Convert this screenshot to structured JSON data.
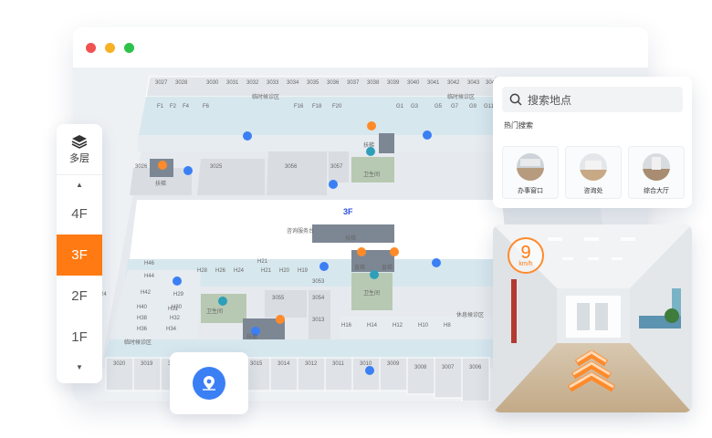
{
  "window": {
    "controls": [
      "close",
      "minimize",
      "maximize"
    ]
  },
  "map": {
    "floor_label": "3F",
    "top_row_units": [
      "3027",
      "3028",
      "3030",
      "3031",
      "3032",
      "3033",
      "3034",
      "3035",
      "3036",
      "3037",
      "3038",
      "3039",
      "3040",
      "3041",
      "3042",
      "3043",
      "3044"
    ],
    "top_area_label": "临时候诊区",
    "top_corridor_units": [
      "F1",
      "F2",
      "F4",
      "F6",
      "F16",
      "F18",
      "F20",
      "G1",
      "G3",
      "G5",
      "G7",
      "G9",
      "G11"
    ],
    "left_block": "3026",
    "mid_blocks": [
      "3025",
      "3056",
      "3057"
    ],
    "escalator_label": "扶梯",
    "elevator_label": "直梯",
    "restroom_label": "卫生间",
    "consult_label": "咨询服务台",
    "right_units": [
      "3052",
      "3050"
    ],
    "lower_row": [
      "H46",
      "H44",
      "H42",
      "H40",
      "H38",
      "H36",
      "H34",
      "H32",
      "H30",
      "H28",
      "H26",
      "H24",
      "H21",
      "H20",
      "H19"
    ],
    "lower_blocks": [
      "3055",
      "3054",
      "3053",
      "3013"
    ],
    "bottom_row": [
      "3020",
      "3019",
      "3018",
      "3017",
      "3016",
      "3015",
      "3014",
      "3012",
      "3011",
      "3010",
      "3009",
      "3008",
      "3007",
      "3006"
    ],
    "left_edge": "24",
    "bottom_area_label": "临时候诊区",
    "rest_area_label": "休息候诊区",
    "h_row_right": [
      "H16",
      "H14",
      "H12",
      "H10",
      "H8"
    ],
    "mid_h_units": [
      "H21",
      "H20"
    ],
    "h29_label": "H29",
    "h31_label": "H31"
  },
  "floor_switcher": {
    "title": "多层",
    "floors": [
      "4F",
      "3F",
      "2F",
      "1F"
    ],
    "active": "3F",
    "icons": [
      "layers-icon",
      "chevron-up-icon",
      "chevron-down-icon"
    ]
  },
  "location_button": {
    "icon": "map-pin-icon",
    "color": "#3b7ff5"
  },
  "search": {
    "placeholder": "搜索地点",
    "hot_title": "热门搜索",
    "hot_items": [
      {
        "label": "办事窗口"
      },
      {
        "label": "咨询处"
      },
      {
        "label": "综合大厅"
      }
    ]
  },
  "preview": {
    "speed_value": "9",
    "speed_unit": "km/h",
    "accent": "#ff7a12"
  }
}
